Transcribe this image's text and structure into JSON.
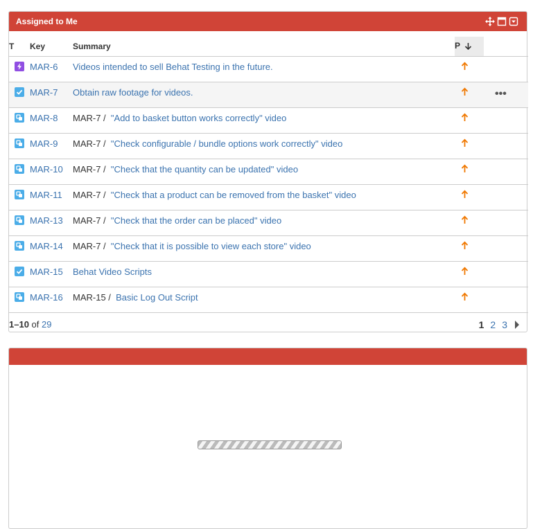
{
  "gadget1": {
    "title": "Assigned to Me",
    "columns": {
      "type": "T",
      "key": "Key",
      "summary": "Summary",
      "priority": "P"
    },
    "rows": [
      {
        "type_icon": "epic-icon",
        "key": "MAR-6",
        "parent": "",
        "summary": "Videos intended to sell Behat Testing in the future."
      },
      {
        "type_icon": "task-icon",
        "key": "MAR-7",
        "parent": "",
        "summary": "Obtain raw footage for videos.",
        "actions": "•••"
      },
      {
        "type_icon": "subtask-icon",
        "key": "MAR-8",
        "parent": "MAR-7 /",
        "summary": "\"Add to basket button works correctly\" video"
      },
      {
        "type_icon": "subtask-icon",
        "key": "MAR-9",
        "parent": "MAR-7 /",
        "summary": "\"Check configurable / bundle options work correctly\" video"
      },
      {
        "type_icon": "subtask-icon",
        "key": "MAR-10",
        "parent": "MAR-7 /",
        "summary": "\"Check that the quantity can be updated\" video"
      },
      {
        "type_icon": "subtask-icon",
        "key": "MAR-11",
        "parent": "MAR-7 /",
        "summary": "\"Check that a product can be removed from the basket\" video"
      },
      {
        "type_icon": "subtask-icon",
        "key": "MAR-13",
        "parent": "MAR-7 /",
        "summary": "\"Check that the order can be placed\" video"
      },
      {
        "type_icon": "subtask-icon",
        "key": "MAR-14",
        "parent": "MAR-7 /",
        "summary": "\"Check that it is possible to view each store\" video"
      },
      {
        "type_icon": "task-icon",
        "key": "MAR-15",
        "parent": "",
        "summary": "Behat Video Scripts"
      },
      {
        "type_icon": "subtask-icon",
        "key": "MAR-16",
        "parent": "MAR-15 /",
        "summary": "Basic Log Out Script"
      }
    ],
    "footer": {
      "range": "1–10",
      "of": "of",
      "total": "29"
    },
    "pagination": {
      "pages": [
        "1",
        "2",
        "3"
      ],
      "current": "1"
    }
  },
  "colors": {
    "header": "#d04437",
    "link": "#3b73af",
    "priority": "#f07800",
    "epic": "#904ee2",
    "task": "#4bade8"
  }
}
